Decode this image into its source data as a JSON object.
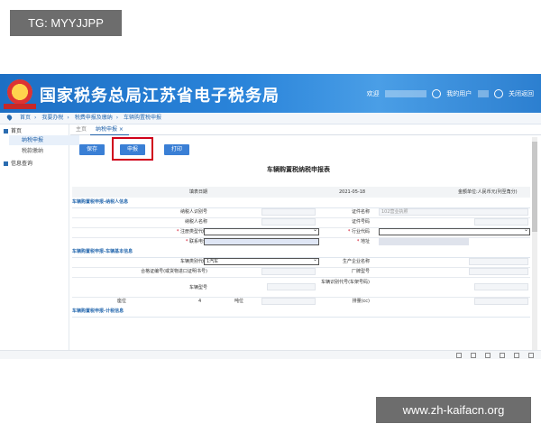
{
  "overlay": {
    "tg": "TG: MYYJJPP",
    "watermark": "www.zh-kaifacn.org"
  },
  "header": {
    "title": "国家税务总局江苏省电子税务局",
    "welcome": "欢迎",
    "user_center": "我的用户",
    "logout": "关闭返回"
  },
  "breadcrumb": [
    "首页",
    "我要办税",
    "税费申报及缴纳",
    "车辆购置税申报"
  ],
  "sidebar": {
    "home": "首页",
    "items": [
      "纳税申报",
      "税款缴纳"
    ],
    "info_query": "信息查询"
  },
  "tabs": [
    "主页",
    "纳税申报 ×"
  ],
  "buttons": {
    "save": "保存",
    "declare": "申报",
    "print": "打印"
  },
  "form": {
    "title": "车辆购置税纳税申报表",
    "fill_date_label": "填表日期",
    "fill_date": "2021-05-18",
    "amount_unit": "金额单位:人民币元(列至角分)",
    "sections": {
      "taxpayer": "车辆购置税申报-纳税人信息",
      "vehicle": "车辆购置税申报-车辆基本信息",
      "tax": "车辆购置税申报-计税信息"
    },
    "taxpayer": {
      "tax_id_label": "纳税人识别号",
      "cert_name_label": "证件名称",
      "cert_name_value": "102营业执照",
      "name_label": "纳税人名称",
      "cert_no_label": "证件号码",
      "reg_type_label": "注册类型代码",
      "industry_label": "行业代码",
      "phone_label": "联系电话",
      "address_label": "地址"
    },
    "vehicle": {
      "category_label": "车辆类别代码",
      "category_value": "1汽车",
      "maker_label": "生产企业名称",
      "cert_label": "合格证编号(或货物进口证明书号)",
      "brand_label": "厂牌型号",
      "vin_label": "车辆识别代号(车架号码)",
      "model_label": "车辆型号",
      "seats_label": "座位",
      "seats_value": "4",
      "tonnage_label": "吨位",
      "displacement_label": "排量(cc)"
    }
  },
  "colors": {
    "banner": "#2a84da",
    "accent": "#3a7fd5",
    "highlight": "#d0021b"
  }
}
